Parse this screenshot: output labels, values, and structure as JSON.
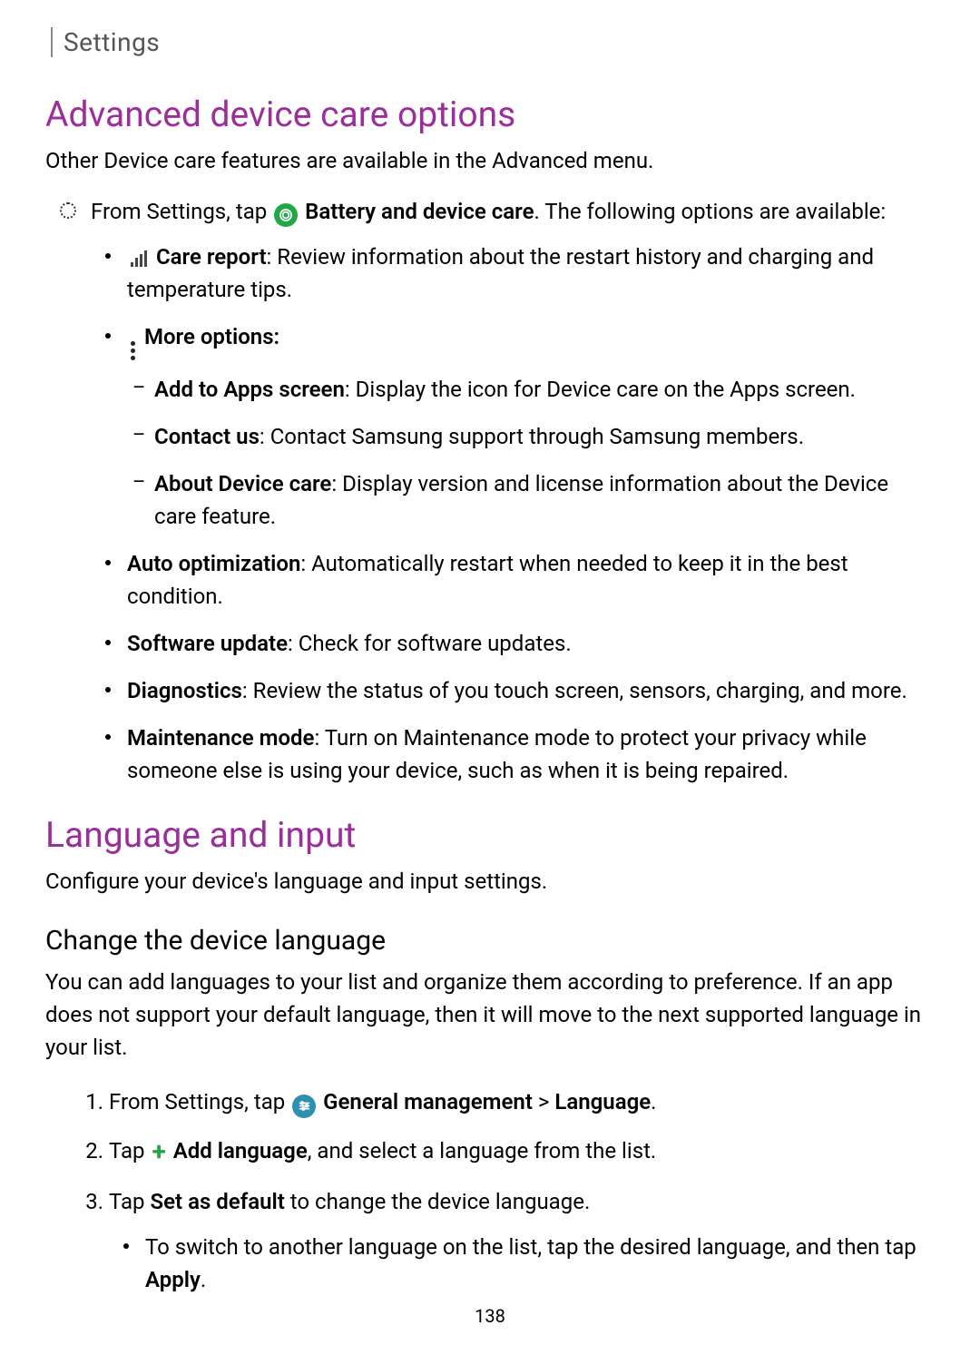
{
  "header": {
    "section": "Settings"
  },
  "s1": {
    "heading": "Advanced device care options",
    "intro": "Other Device care features are available in the Advanced menu.",
    "main_line_pre": "From Settings, tap ",
    "main_bold": "Battery and device care",
    "main_line_post": ". The following options are available:",
    "care_report_label": "Care report",
    "care_report_text": ": Review information about the restart history and charging and temperature tips.",
    "more_options_label": "More options:",
    "opt_add_apps_label": "Add to Apps screen",
    "opt_add_apps_text": ": Display the icon for Device care on the Apps screen.",
    "opt_contact_label": "Contact us",
    "opt_contact_text": ": Contact Samsung support through Samsung members.",
    "opt_about_label": "About Device care",
    "opt_about_text": ": Display version and license information about the Device care feature.",
    "auto_opt_label": "Auto optimization",
    "auto_opt_text": ": Automatically restart when needed to keep it in the best condition.",
    "sw_update_label": "Software update",
    "sw_update_text": ": Check for software updates.",
    "diag_label": "Diagnostics",
    "diag_text": ": Review the status of you touch screen, sensors, charging, and more.",
    "maint_label": "Maintenance mode",
    "maint_text": ": Turn on Maintenance mode to protect your privacy while someone else is using your device, such as when it is being repaired."
  },
  "s2": {
    "heading": "Language and input",
    "intro": "Configure your device's language and input settings.",
    "sub_heading": "Change the device language",
    "sub_intro": "You can add languages to your list and organize them according to preference. If an app does not support your default language, then it will move to the next supported language in your list.",
    "step1_pre": "From Settings, tap ",
    "step1_bold_a": "General management",
    "step1_gt": " > ",
    "step1_bold_b": "Language",
    "step1_post": ".",
    "step2_pre": "Tap ",
    "step2_bold": "Add language",
    "step2_post": ", and select a language from the list.",
    "step3_pre": "Tap ",
    "step3_bold": "Set as default",
    "step3_post": " to change the device language.",
    "step3_sub_pre": "To switch to another language on the list, tap the desired language, and then tap ",
    "step3_sub_bold": "Apply",
    "step3_sub_post": "."
  },
  "page_number": "138"
}
